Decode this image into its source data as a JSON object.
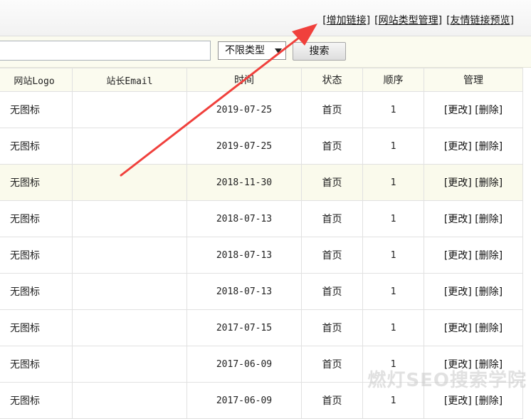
{
  "toplinks": {
    "open": "[",
    "close": "]",
    "add_link": "增加链接",
    "type_manage": "网站类型管理",
    "preview": "友情链接预览"
  },
  "search": {
    "input_value": "",
    "type_selected": "不限类型",
    "button_label": "搜索"
  },
  "table": {
    "headers": [
      "网站Logo",
      "站长Email",
      "时间",
      "状态",
      "顺序",
      "管理"
    ],
    "rows": [
      {
        "logo": "无图标",
        "email": "",
        "date": "2019-07-25",
        "status": "首页",
        "order": "1"
      },
      {
        "logo": "无图标",
        "email": "",
        "date": "2019-07-25",
        "status": "首页",
        "order": "1"
      },
      {
        "logo": "无图标",
        "email": "",
        "date": "2018-11-30",
        "status": "首页",
        "order": "1"
      },
      {
        "logo": "无图标",
        "email": "",
        "date": "2018-07-13",
        "status": "首页",
        "order": "1"
      },
      {
        "logo": "无图标",
        "email": "",
        "date": "2018-07-13",
        "status": "首页",
        "order": "1"
      },
      {
        "logo": "无图标",
        "email": "",
        "date": "2018-07-13",
        "status": "首页",
        "order": "1"
      },
      {
        "logo": "无图标",
        "email": "",
        "date": "2017-07-15",
        "status": "首页",
        "order": "1"
      },
      {
        "logo": "无图标",
        "email": "",
        "date": "2017-06-09",
        "status": "首页",
        "order": "1"
      },
      {
        "logo": "无图标",
        "email": "",
        "date": "2017-06-09",
        "status": "首页",
        "order": "1"
      }
    ],
    "edit_label": "[更改]",
    "delete_label": "[删除]"
  },
  "watermark": "燃灯SEO搜索学院",
  "colors": {
    "annotation_arrow": "#f0403c",
    "header_bg": "#fbfbef",
    "highlight_row_bg": "#fafaec"
  }
}
